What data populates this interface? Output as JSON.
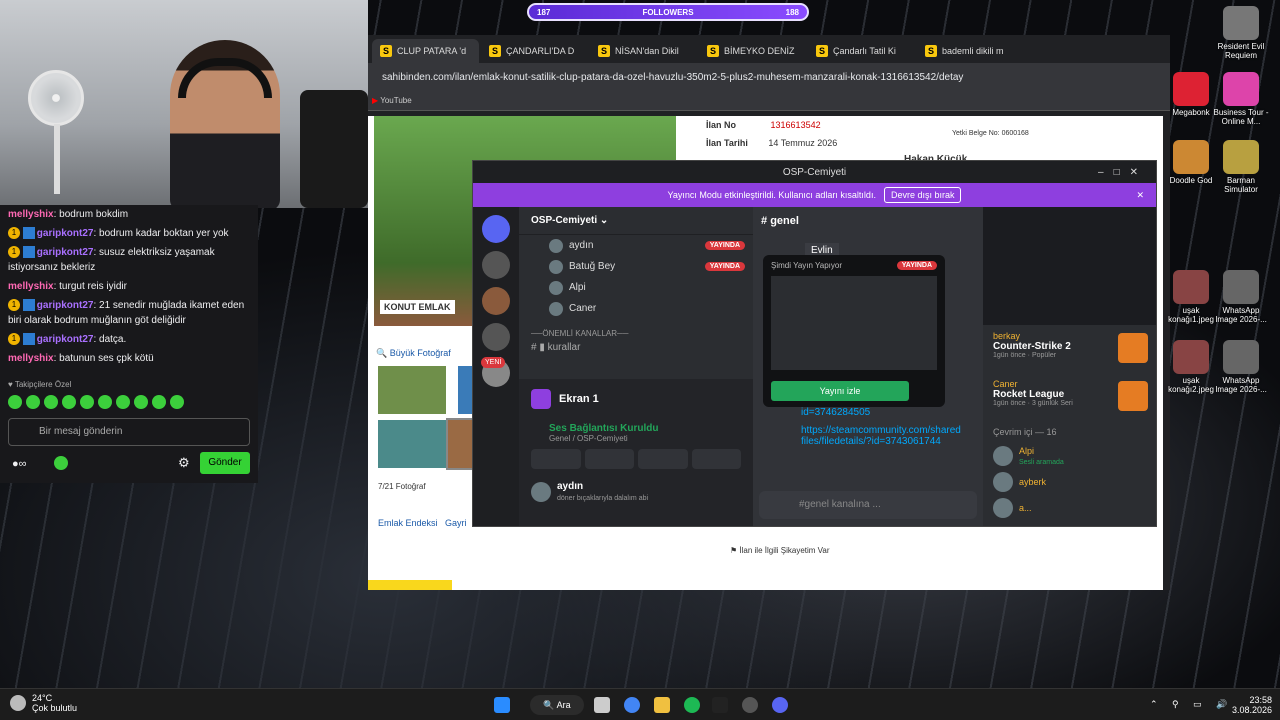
{
  "followers": {
    "left": "187",
    "label": "FOLLOWERS",
    "right": "188"
  },
  "chat": {
    "messages": [
      {
        "user": "mellyshix",
        "text": "bodrum bokdim",
        "kind": "u2"
      },
      {
        "user": "garipkont27",
        "text": "bodrum kadar boktan yer yok",
        "kind": "u1"
      },
      {
        "user": "garipkont27",
        "text": "susuz elektriksiz yaşamak istiyorsanız bekleriz",
        "kind": "u1"
      },
      {
        "user": "mellyshix",
        "text": "turgut reis iyidir",
        "kind": "u2"
      },
      {
        "user": "garipkont27",
        "text": "21 senedir muğlada ikamet eden biri olarak bodrum muğlanın göt deliğidir",
        "kind": "u1"
      },
      {
        "user": "garipkont27",
        "text": "datça.",
        "kind": "u1"
      },
      {
        "user": "mellyshix",
        "text": "batunun ses çpk kötü",
        "kind": "u2"
      }
    ],
    "followers_only": "Takipçilere Özel",
    "input_placeholder": "Bir mesaj gönderin",
    "send_label": "Gönder"
  },
  "browser": {
    "tabs": [
      "CLUP PATARA 'd",
      "ÇANDARLI'DA D",
      "NİSAN'dan Dikil",
      "BİMEYKO DENİZ",
      "Çandarlı Tatil Ki",
      "bademli dikili m"
    ],
    "url": "sahibinden.com/ilan/emlak-konut-satilik-clup-patara-da-ozel-havuzlu-350m2-5-plus2-muhesem-manzarali-konak-1316613542/detay",
    "bookmark": "YouTube",
    "ilan_no_label": "İlan No",
    "ilan_no": "1316613542",
    "ilan_tarih_label": "İlan Tarihi",
    "ilan_tarih": "14 Temmuz 2026",
    "yetki": "Yetki Belge No:",
    "yetki_no": "0600168",
    "agent": "Hakan Küçük",
    "logo": "KONUT EMLAK",
    "big_photo": "Büyük Fotoğraf",
    "photo_count": "7/21 Fotoğraf",
    "footer_link1": "Emlak Endeksi",
    "footer_link2": "Gayri",
    "complaint": "İlan ile İlgili Şikayetim Var"
  },
  "discord": {
    "title": "OSP-Cemiyeti",
    "streamer_mode": "Yayıncı Modu etkinleştirildi. Kullanıcı adları kısaltıldı.",
    "disable_btn": "Devre dışı bırak",
    "server": "OSP-Cemiyeti",
    "members": [
      {
        "name": "aydın",
        "live": "YAYINDA"
      },
      {
        "name": "Batuğ Bey",
        "live": "YAYINDA"
      },
      {
        "name": "Alpi",
        "live": ""
      },
      {
        "name": "Caner",
        "live": ""
      }
    ],
    "category": "ÖNEMLİ KANALLAR",
    "channel": "kurallar",
    "new_badge": "YENİ",
    "screen": "Ekran 1",
    "voice_status": "Ses Bağlantısı Kuruldu",
    "voice_sub": "Genel / OSP-Cemiyeti",
    "user": "aydın",
    "user_status": "döner bıçaklarıyla dalalım abi",
    "channel_name": "genel",
    "popup_title": "Şimdi Yayın Yapıyor",
    "popup_live": "YAYINDA",
    "watch": "Yayını izle",
    "msg_user": "Evlin",
    "link1": "id=3746284505",
    "link2": "https://steamcommunity.com/sharedfiles/filedetails/?id=3743061744",
    "input_placeholder": "#genel kanalına ...",
    "activities": [
      {
        "user": "berkay",
        "game": "Counter-Strike 2",
        "time": "1gün önce",
        "extra": "Popüler"
      },
      {
        "user": "Caner",
        "game": "Rocket League",
        "time": "1gün önce",
        "extra": "3 günlük Seri"
      }
    ],
    "online": "Çevrim içi — 16",
    "online_members": [
      {
        "name": "Alpi",
        "sub": "Sesli aramada"
      },
      {
        "name": "ayberk",
        "sub": ""
      },
      {
        "name": "a...",
        "sub": ""
      }
    ]
  },
  "desktop_icons": [
    {
      "label": "Resident Evil Requiem",
      "color": "#777"
    },
    {
      "label": "Megabonk",
      "color": "#d23"
    },
    {
      "label": "Business Tour - Online M...",
      "color": "#d4a"
    },
    {
      "label": "Doodle God",
      "color": "#c83"
    },
    {
      "label": "Barman Simulator",
      "color": "#b8a040"
    },
    {
      "label": "uşak konağı1.jpeg",
      "color": "#844"
    },
    {
      "label": "WhatsApp Image 2026-...",
      "color": "#666"
    },
    {
      "label": "uşak konağı2.jpeg",
      "color": "#844"
    },
    {
      "label": "WhatsApp Image 2026-...",
      "color": "#666"
    }
  ],
  "taskbar": {
    "weather": "24°C",
    "weather_sub": "Çok bulutlu",
    "search": "Ara",
    "time": "23:58",
    "date": "3.08.2026"
  }
}
